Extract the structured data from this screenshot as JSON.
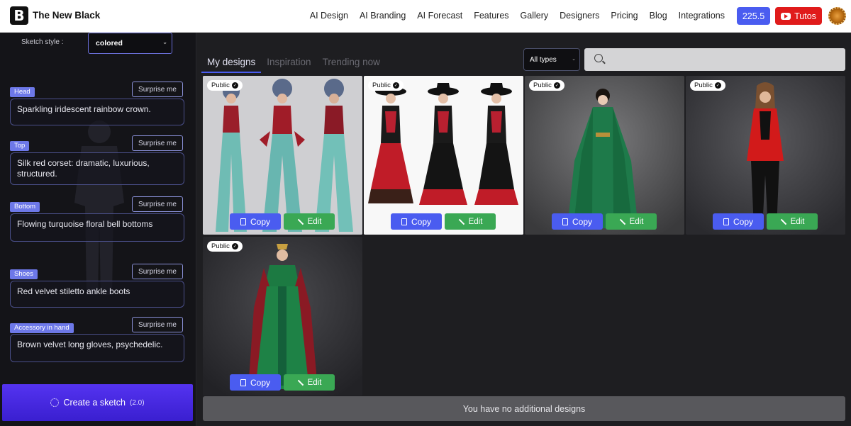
{
  "header": {
    "logo_letter": "B",
    "brand": "The New Black",
    "nav": [
      "AI Design",
      "AI Branding",
      "AI Forecast",
      "Features",
      "Gallery",
      "Designers",
      "Pricing",
      "Blog",
      "Integrations"
    ],
    "credits": "225.5",
    "tutos_label": "Tutos"
  },
  "sidebar": {
    "sketch_style_label": "Sketch style :",
    "sketch_style_value": "colored",
    "surprise_label": "Surprise me",
    "fields": {
      "head": {
        "tag": "Head",
        "value": "Sparkling iridescent rainbow crown."
      },
      "top": {
        "tag": "Top",
        "value": "Silk red corset: dramatic, luxurious, structured."
      },
      "bottom": {
        "tag": "Bottom",
        "value": "Flowing turquoise floral bell bottoms"
      },
      "shoes": {
        "tag": "Shoes",
        "value": "Red velvet stiletto ankle boots"
      },
      "accessory": {
        "tag": "Accessory in hand",
        "value": "Brown velvet long gloves, psychedelic."
      }
    },
    "create_label": "Create a sketch",
    "create_version": "(2.0)"
  },
  "main": {
    "tabs": [
      "My designs",
      "Inspiration",
      "Trending now"
    ],
    "type_filter": "All types",
    "search_placeholder": "",
    "badge": "Public",
    "copy_label": "Copy",
    "edit_label": "Edit",
    "no_more": "You have no additional designs"
  },
  "colors": {
    "accent": "#4a5cf0",
    "edit_green": "#3aa854",
    "create_purple": "#4527e0",
    "tutos_red": "#e01b1b"
  }
}
